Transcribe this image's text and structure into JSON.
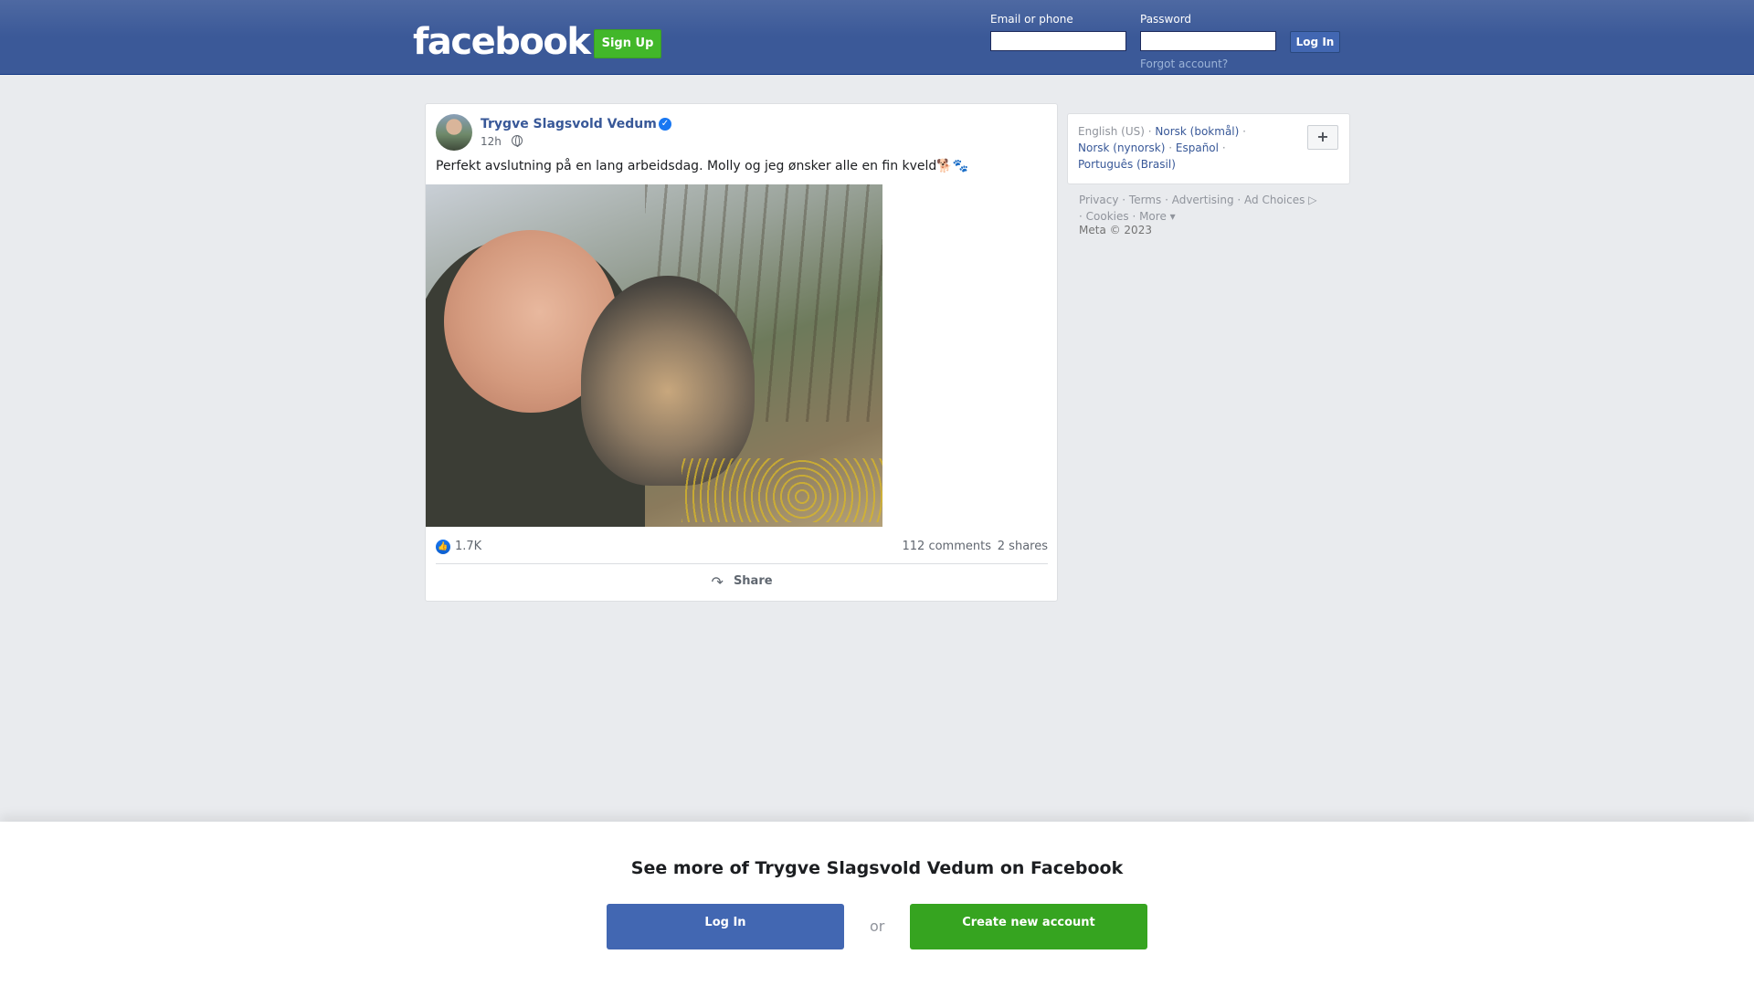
{
  "header": {
    "logo": "facebook",
    "signup_label": "Sign Up",
    "email_label": "Email or phone",
    "password_label": "Password",
    "login_label": "Log In",
    "forgot_label": "Forgot account?"
  },
  "post": {
    "author": "Trygve Slagsvold Vedum",
    "time": "12h",
    "text": "Perfekt avslutning på en lang arbeidsdag. Molly og jeg ønsker alle en fin kveld🐕🐾",
    "reactions_count": "1.7K",
    "comments_count": "112 comments",
    "shares_count": "2 shares",
    "share_label": "Share"
  },
  "sidebar": {
    "languages": {
      "current": "English (US)",
      "options": [
        "Norsk (bokmål)",
        "Norsk (nynorsk)",
        "Español",
        "Português (Brasil)"
      ],
      "add_label": "+"
    },
    "footer_links": [
      "Privacy",
      "Terms",
      "Advertising",
      "Ad Choices",
      "Cookies",
      "More"
    ],
    "copyright": "Meta © 2023"
  },
  "bottom_prompt": {
    "title": "See more of Trygve Slagsvold Vedum on Facebook",
    "login_label": "Log In",
    "or_label": "or",
    "create_label": "Create new account"
  },
  "colors": {
    "brand_blue": "#3b5998",
    "link_blue": "#385898",
    "signup_green": "#42b72a",
    "verified_blue": "#1877f2"
  }
}
